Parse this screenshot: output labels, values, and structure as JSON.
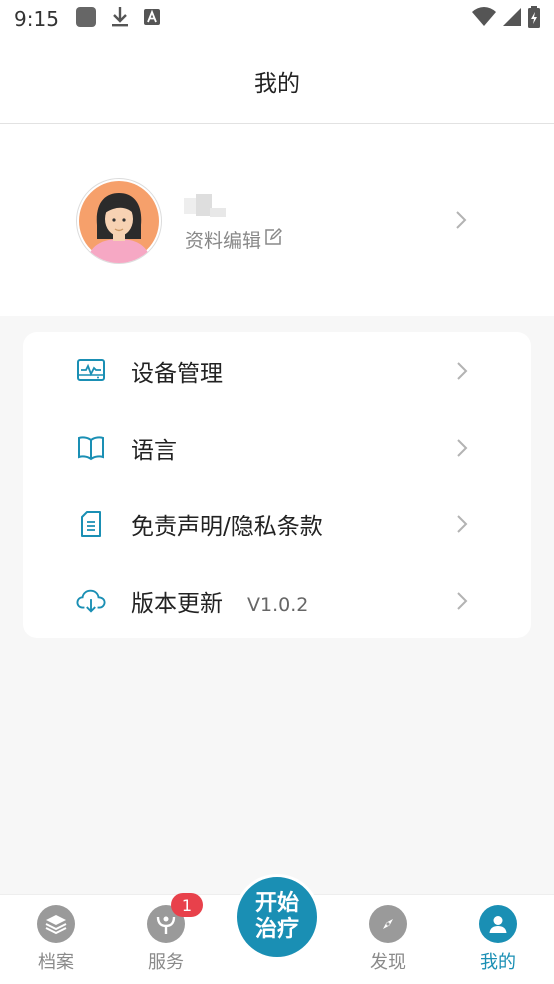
{
  "status_bar": {
    "time": "9:15",
    "left_icons": [
      "app-square-icon",
      "download-icon",
      "a-badge-icon"
    ],
    "right_icons": [
      "wifi-icon",
      "signal-icon",
      "battery-icon"
    ]
  },
  "header": {
    "title": "我的"
  },
  "profile": {
    "edit_label": "资料编辑",
    "avatar_icon": "avatar-woman-icon"
  },
  "menu": {
    "items": [
      {
        "label": "设备管理",
        "icon": "device-monitor-icon"
      },
      {
        "label": "语言",
        "icon": "book-icon"
      },
      {
        "label": "免责声明/隐私条款",
        "icon": "document-icon"
      },
      {
        "label": "版本更新",
        "icon": "cloud-download-icon",
        "version": "V1.0.2"
      }
    ]
  },
  "tabbar": {
    "tabs": [
      {
        "label": "档案",
        "icon": "layers-icon"
      },
      {
        "label": "服务",
        "icon": "service-icon",
        "badge": "1"
      },
      {
        "label": "发现",
        "icon": "compass-icon"
      },
      {
        "label": "我的",
        "icon": "user-icon",
        "active": true
      }
    ],
    "center_button": {
      "line1": "开始",
      "line2": "治疗"
    }
  },
  "colors": {
    "accent": "#1a8fb4",
    "badge": "#e8414b",
    "inactive": "#9a9a9a",
    "background": "#f7f7f7"
  }
}
